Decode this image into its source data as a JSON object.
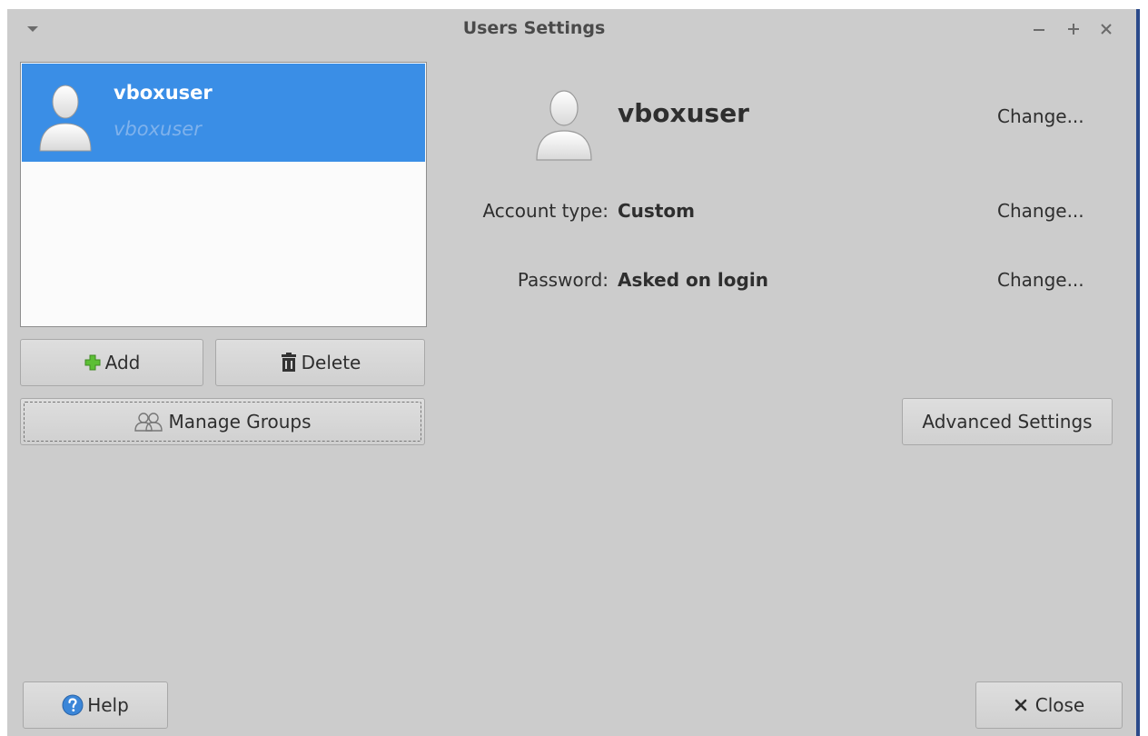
{
  "window": {
    "title": "Users Settings"
  },
  "user_list": [
    {
      "name": "vboxuser",
      "login": "vboxuser",
      "selected": true
    }
  ],
  "buttons": {
    "add": "Add",
    "delete": "Delete",
    "manage_groups": "Manage Groups",
    "advanced_settings": "Advanced Settings",
    "help": "Help",
    "close": "Close"
  },
  "details": {
    "name": "vboxuser",
    "name_action": "Change...",
    "account_type_label": "Account type:",
    "account_type_value": "Custom",
    "account_type_action": "Change...",
    "password_label": "Password:",
    "password_value": "Asked on login",
    "password_action": "Change..."
  },
  "colors": {
    "window_bg": "#cccccc",
    "selection": "#3a8ee6",
    "list_bg": "#fbfbfb",
    "add_icon": "#4fae2e",
    "help_icon": "#3b86d8"
  },
  "icons": {
    "window_menu": "chevron-down-icon",
    "minimize": "minimize-icon",
    "maximize": "maximize-icon",
    "close_window": "close-icon",
    "avatar": "user-avatar-icon",
    "add": "plus-icon",
    "delete": "trash-icon",
    "groups": "group-icon",
    "help": "help-icon",
    "close": "x-icon"
  }
}
